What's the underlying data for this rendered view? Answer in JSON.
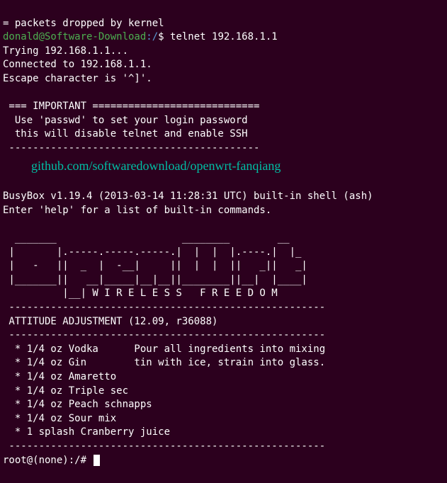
{
  "line0": "= packets dropped by kernel",
  "prompt1_user": "donald@Software-Download",
  "prompt1_path": ":/",
  "prompt1_symbol": "$ ",
  "command1": "telnet 192.168.1.1",
  "output1": "Trying 192.168.1.1...",
  "output2": "Connected to 192.168.1.1.",
  "output3": "Escape character is '^]'.",
  "blank1": "",
  "important_header": " === IMPORTANT ============================",
  "important_line1": "  Use 'passwd' to set your login password",
  "important_line2": "  this will disable telnet and enable SSH",
  "important_footer": " ------------------------------------------",
  "github_url": "github.com/softwaredownload/openwrt-fanqiang",
  "blank2": "",
  "busybox1": "BusyBox v1.19.4 (2013-03-14 11:28:31 UTC) built-in shell (ash)",
  "busybox2": "Enter 'help' for a list of built-in commands.",
  "blank3": "",
  "ascii1": "  _______                     ________        __",
  "ascii2": " |       |.-----.-----.-----.|  |  |  |.----.|  |_",
  "ascii3": " |   -   ||  _  |  -__|     ||  |  |  ||   _||   _|",
  "ascii4": " |_______||   __|_____|__|__||________||__|  |____|",
  "ascii5": "          |__| W I R E L E S S   F R E E D O M",
  "divider1": " -----------------------------------------------------",
  "release": " ATTITUDE ADJUSTMENT (12.09, r36088)",
  "divider2": " -----------------------------------------------------",
  "recipe1": "  * 1/4 oz Vodka      Pour all ingredients into mixing",
  "recipe2": "  * 1/4 oz Gin        tin with ice, strain into glass.",
  "recipe3": "  * 1/4 oz Amaretto",
  "recipe4": "  * 1/4 oz Triple sec",
  "recipe5": "  * 1/4 oz Peach schnapps",
  "recipe6": "  * 1/4 oz Sour mix",
  "recipe7": "  * 1 splash Cranberry juice",
  "divider3": " -----------------------------------------------------",
  "root_prompt": "root@(none):/# "
}
